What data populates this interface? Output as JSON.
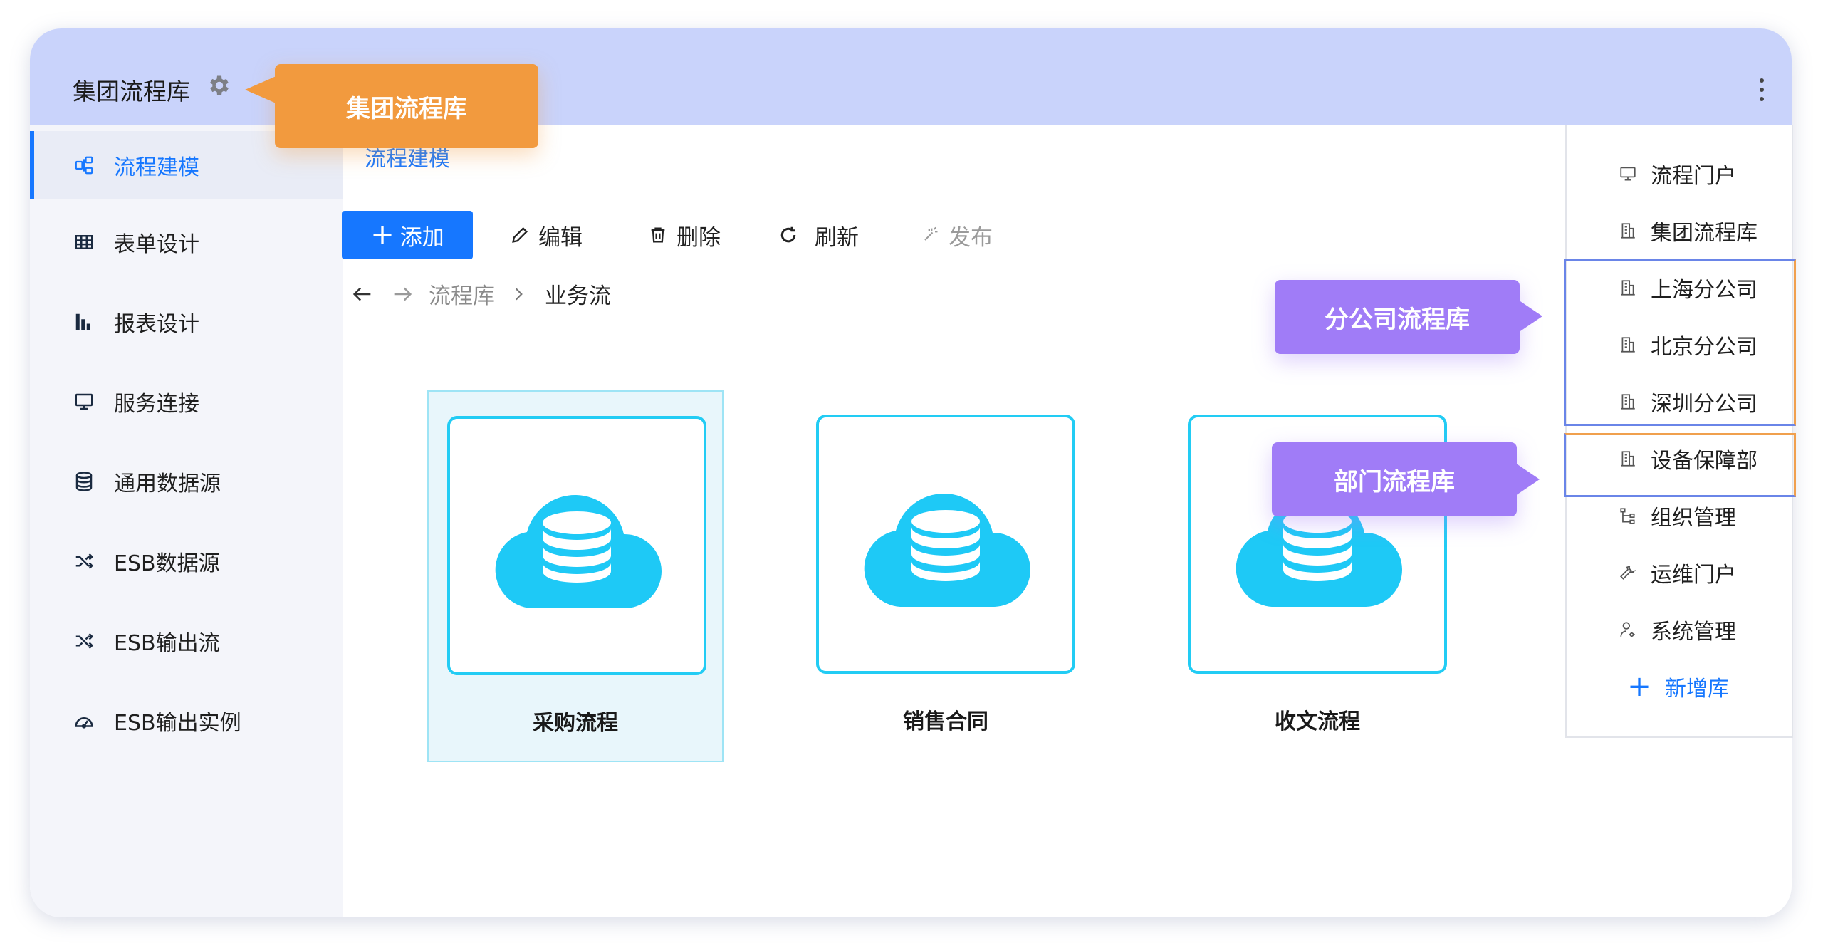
{
  "header": {
    "title": "集团流程库",
    "settings_icon": "gear-icon",
    "more_icon": "more-vertical-icon"
  },
  "sidebar": {
    "items": [
      {
        "label": "流程建模",
        "icon": "flow-model-icon",
        "active": true
      },
      {
        "label": "表单设计",
        "icon": "table-icon",
        "active": false
      },
      {
        "label": "报表设计",
        "icon": "bar-chart-icon",
        "active": false
      },
      {
        "label": "服务连接",
        "icon": "monitor-icon",
        "active": false
      },
      {
        "label": "通用数据源",
        "icon": "database-icon",
        "active": false
      },
      {
        "label": "ESB数据源",
        "icon": "shuffle-icon",
        "active": false
      },
      {
        "label": "ESB输出流",
        "icon": "shuffle-icon",
        "active": false
      },
      {
        "label": "ESB输出实例",
        "icon": "dashboard-icon",
        "active": false
      }
    ]
  },
  "main": {
    "section_title": "流程建模",
    "toolbar": {
      "add": "添加",
      "edit": "编辑",
      "delete": "删除",
      "refresh": "刷新",
      "publish": "发布"
    },
    "path": {
      "root": "流程库",
      "current": "业务流"
    },
    "cards": [
      {
        "label": "采购流程",
        "selected": true
      },
      {
        "label": "销售合同",
        "selected": false
      },
      {
        "label": "收文流程",
        "selected": false
      }
    ]
  },
  "menu": {
    "items": [
      {
        "label": "流程门户",
        "icon": "monitor-icon"
      },
      {
        "label": "集团流程库",
        "icon": "building-icon"
      },
      {
        "label": "上海分公司",
        "icon": "building-icon"
      },
      {
        "label": "北京分公司",
        "icon": "building-icon"
      },
      {
        "label": "深圳分公司",
        "icon": "building-icon"
      },
      {
        "label": "设备保障部",
        "icon": "building-icon"
      },
      {
        "label": "组织管理",
        "icon": "org-tree-icon"
      },
      {
        "label": "运维门户",
        "icon": "wrench-icon"
      },
      {
        "label": "系统管理",
        "icon": "user-settings-icon"
      }
    ],
    "add_label": "新增库"
  },
  "callouts": {
    "group": "集团流程库",
    "branch": "分公司流程库",
    "department": "部门流程库"
  },
  "colors": {
    "accent": "#1677ff",
    "header_bg": "#c9d3fb",
    "card_border": "#22ccf4",
    "cloud": "#1ec9f6",
    "tip_orange": "#f29a3e",
    "tip_purple": "#a07cf7"
  }
}
